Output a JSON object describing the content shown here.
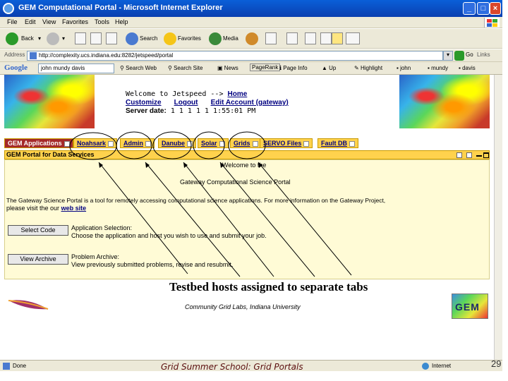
{
  "window": {
    "title": "GEM Computational Portal - Microsoft Internet Explorer",
    "buttons": [
      "_",
      "□",
      "×"
    ]
  },
  "menubar": [
    "File",
    "Edit",
    "View",
    "Favorites",
    "Tools",
    "Help"
  ],
  "toolbar": {
    "back": "Back",
    "search": "Search",
    "favorites": "Favorites",
    "media": "Media"
  },
  "addressbar": {
    "label": "Address",
    "url": "http://complexity.ucs.indiana.edu:8282/jetspeed/portal",
    "go": "Go",
    "links": "Links"
  },
  "googlebar": {
    "logo": "Google",
    "query": "john mundy davis",
    "items": [
      "Search Web",
      "Search Site",
      "News",
      "PageRank",
      "Page Info",
      "Up",
      "Highlight",
      "john",
      "mundy",
      "davis"
    ]
  },
  "portal": {
    "welcome": "Welcome to Jetspeed -->",
    "home": "Home",
    "customize": "Customize",
    "logout": "Logout",
    "edit_account": "Edit Account (gateway)",
    "server_date_label": "Server date:",
    "server_date": "1 1 1 1 1 1:55:01 PM"
  },
  "tabs": [
    "GEM Applications",
    "Noahsark",
    "Admin",
    "Danube",
    "Solar",
    "Grids",
    "SERVO Files",
    "Fault DB"
  ],
  "portlet": {
    "title": "GEM Portal for Data Services",
    "welcome": "Welcome to the",
    "heading": "Gateway Computational Science Portal",
    "intro": "The Gateway Science Portal is a tool for remotely accessing computational science applications. For more information on the Gateway Project,",
    "intro2": "please visit the our",
    "web_site": "web site",
    "select_code": "Select Code",
    "app_selection_title": "Application Selection:",
    "app_selection_desc": "Choose the application and host you wish to use and submit your job.",
    "view_archive": "View Archive",
    "problem_archive_title": "Problem Archive:",
    "problem_archive_desc": "View previously submitted problems, revise and resubmit."
  },
  "annotation": "Testbed hosts assigned to separate tabs",
  "footer": {
    "cgl": "Community Grid Labs, Indiana University",
    "gem": "GEM"
  },
  "statusbar": {
    "done": "Done",
    "zone": "Internet"
  },
  "slide": {
    "footer": "Grid Summer School: Grid Portals",
    "number": "29"
  }
}
